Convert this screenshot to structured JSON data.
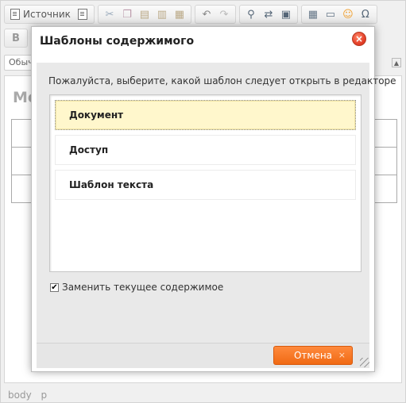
{
  "editor": {
    "toolbar": {
      "source_label": "Источник",
      "bold_label": "B",
      "format_value": "Обыч"
    },
    "content_heading": "Ме",
    "status_path": [
      "body",
      "p"
    ]
  },
  "dialog": {
    "title": "Шаблоны содержимого",
    "instructions": "Пожалуйста, выберите, какой шаблон следует открыть в редакторе",
    "templates": [
      {
        "label": "Документ",
        "selected": true
      },
      {
        "label": "Доступ",
        "selected": false
      },
      {
        "label": "Шаблон текста",
        "selected": false
      }
    ],
    "replace_checkbox": {
      "label": "Заменить текущее содержимое",
      "checked": true
    },
    "cancel_label": "Отмена",
    "close_symbol": "×",
    "cancel_symbol": "×"
  },
  "colors": {
    "accent": "#f06a14",
    "selected_item_bg": "#fff7cc",
    "close_button": "#e5402a"
  },
  "icons": {
    "toolbar": [
      "document-icon",
      "cut-icon",
      "copy-icon",
      "paste-icon",
      "paste-text-icon",
      "paste-word-icon",
      "undo-icon",
      "redo-icon",
      "find-icon",
      "replace-icon",
      "select-all-icon",
      "table-icon",
      "horizontal-rule-icon",
      "smiley-icon",
      "special-char-icon"
    ],
    "close": "close-icon",
    "checkbox": "checkmark-icon"
  }
}
